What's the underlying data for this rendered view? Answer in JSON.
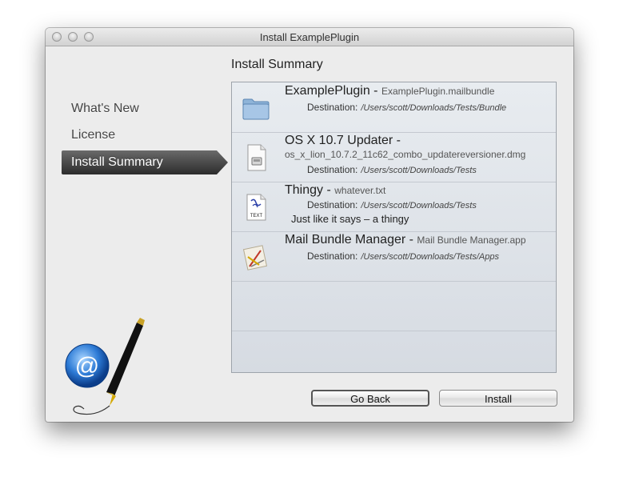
{
  "window": {
    "title": "Install ExamplePlugin"
  },
  "sidebar": {
    "items": [
      {
        "label": "What's New"
      },
      {
        "label": "License"
      },
      {
        "label": "Install Summary",
        "selected": true
      }
    ]
  },
  "main": {
    "title": "Install Summary",
    "destination_label": "Destination:",
    "items": [
      {
        "name": "ExamplePlugin",
        "separator": " - ",
        "file": "ExamplePlugin.mailbundle",
        "destination": "/Users/scott/Downloads/Tests/Bundle",
        "icon": "folder-icon"
      },
      {
        "name": "OS X 10.7 Updater",
        "separator": " - ",
        "file": "os_x_lion_10.7.2_11c62_combo_updatereversioner.dmg",
        "destination": "/Users/scott/Downloads/Tests",
        "icon": "disk-image-icon"
      },
      {
        "name": "Thingy",
        "separator": " - ",
        "file": "whatever.txt",
        "destination": "/Users/scott/Downloads/Tests",
        "description": "Just like it says – a thingy",
        "icon": "text-file-icon"
      },
      {
        "name": "Mail Bundle Manager",
        "separator": " - ",
        "file": "Mail Bundle Manager.app",
        "destination": "/Users/scott/Downloads/Tests/Apps",
        "icon": "app-icon"
      }
    ]
  },
  "buttons": {
    "back": "Go Back",
    "install": "Install"
  },
  "text_icon_label": "TEXT",
  "colors": {
    "selected_bg": "#3a3a3a",
    "list_bg": "#e3e7ec"
  }
}
